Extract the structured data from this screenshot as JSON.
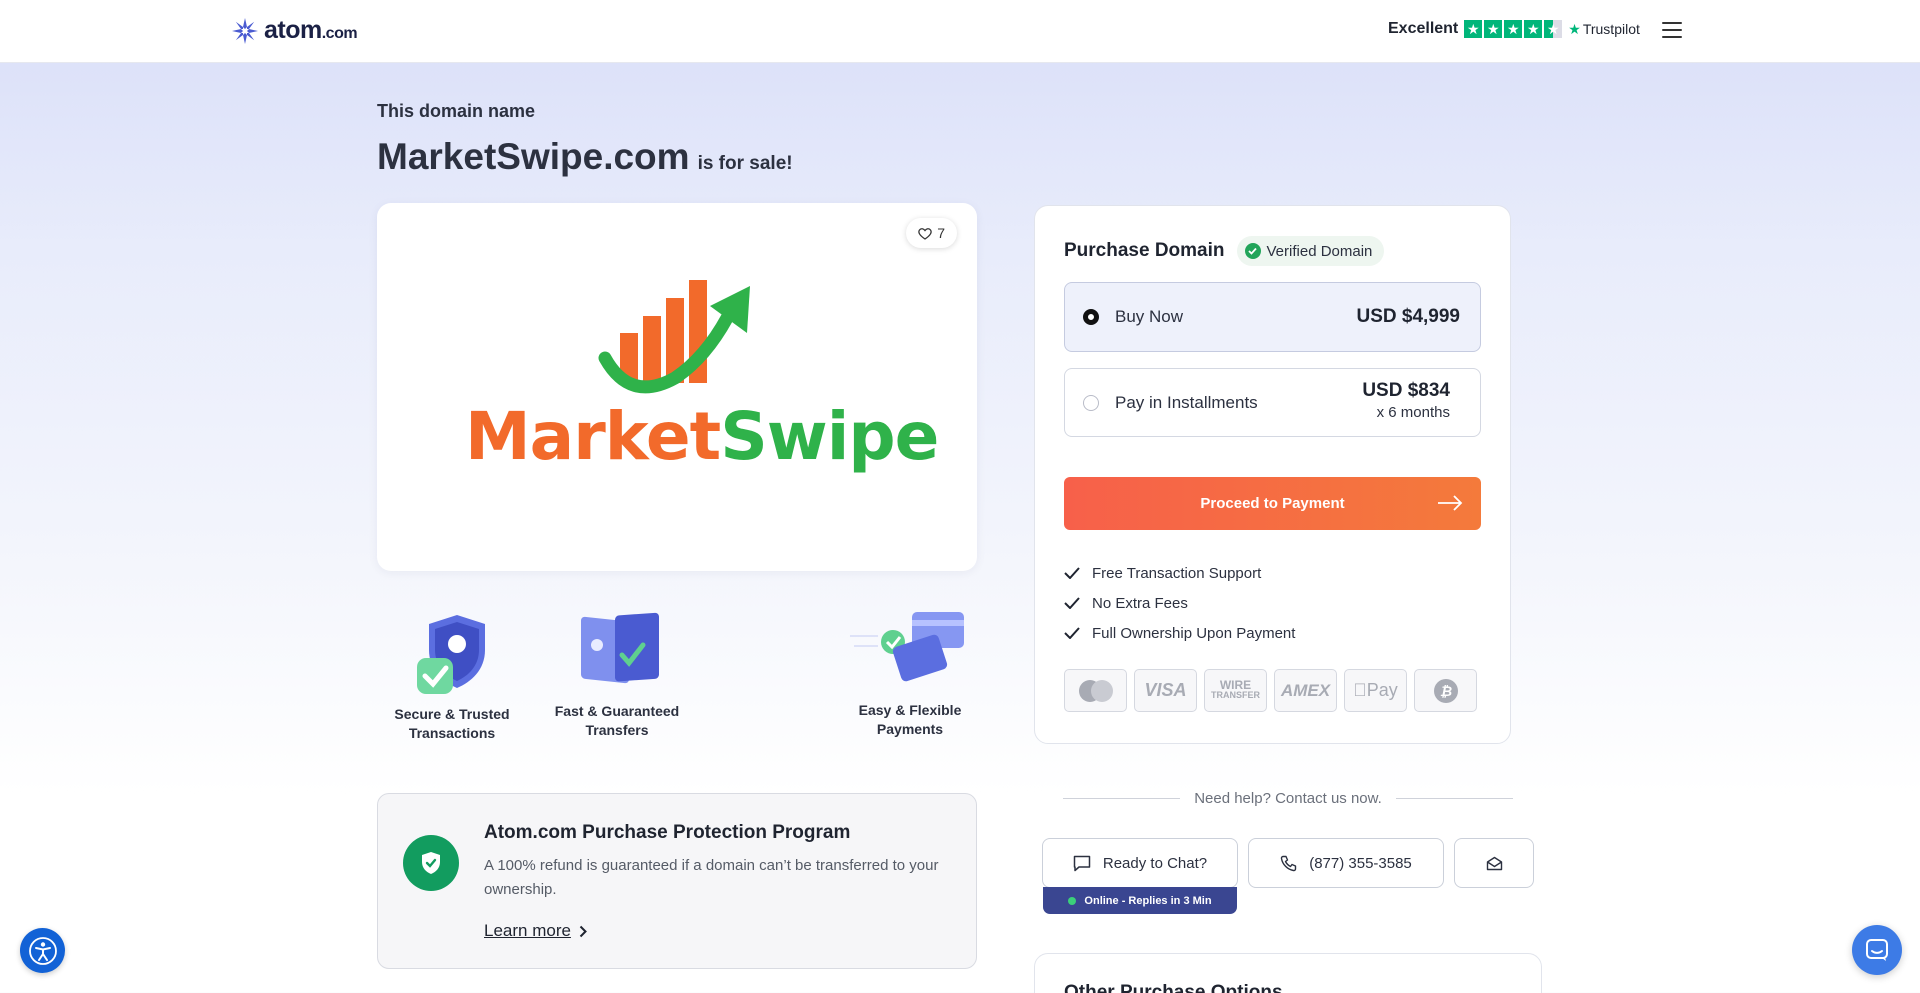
{
  "header": {
    "logo_text": "atom",
    "logo_suffix": ".com",
    "trust_label": "Excellent",
    "trust_brand": "Trustpilot",
    "trust_star_color": "#00b67a"
  },
  "hero": {
    "intro": "This domain name",
    "domain": "MarketSwipe.com",
    "for_sale": "is for sale!"
  },
  "logo_card": {
    "likes": "7",
    "brand_part1": "Market",
    "brand_part2": "Swipe",
    "brand_colors": {
      "orange": "#f26a2b",
      "green": "#2fb24a"
    }
  },
  "features": [
    {
      "label_line1": "Secure & Trusted",
      "label_line2": "Transactions",
      "icon": "shield-check-icon"
    },
    {
      "label_line1": "Fast & Guaranteed",
      "label_line2": "Transfers",
      "icon": "transfer-icon"
    },
    {
      "label_line1": "Easy & Flexible",
      "label_line2": "Payments",
      "icon": "credit-card-icon"
    }
  ],
  "protection": {
    "title": "Atom.com Purchase Protection Program",
    "text": "A 100% refund is guaranteed if a domain can’t be transferred to your ownership.",
    "link": "Learn more"
  },
  "purchase": {
    "title": "Purchase Domain",
    "verified": "Verified Domain",
    "options": [
      {
        "label": "Buy Now",
        "price": "USD $4,999",
        "selected": true
      },
      {
        "label": "Pay in Installments",
        "price": "USD $834",
        "note": "x 6 months",
        "selected": false
      }
    ],
    "cta": "Proceed to Payment",
    "cta_color": "#f7604a",
    "benefits": [
      "Free Transaction Support",
      "No Extra Fees",
      "Full Ownership Upon Payment"
    ],
    "payment_methods": [
      "mastercard-icon",
      "visa-icon",
      "wire-transfer-icon",
      "amex-icon",
      "apple-pay-icon",
      "bitcoin-icon"
    ],
    "payment_labels": {
      "visa": "VISA",
      "wire1": "WIRE",
      "wire2": "TRANSFER",
      "amex": "AMEX",
      "apple": "Pay"
    }
  },
  "help": {
    "text": "Need help? Contact us now.",
    "chat": "Ready to Chat?",
    "chat_status": "Online - Replies in 3 Min",
    "phone": "(877) 355-3585"
  },
  "other": {
    "title": "Other Purchase Options"
  }
}
